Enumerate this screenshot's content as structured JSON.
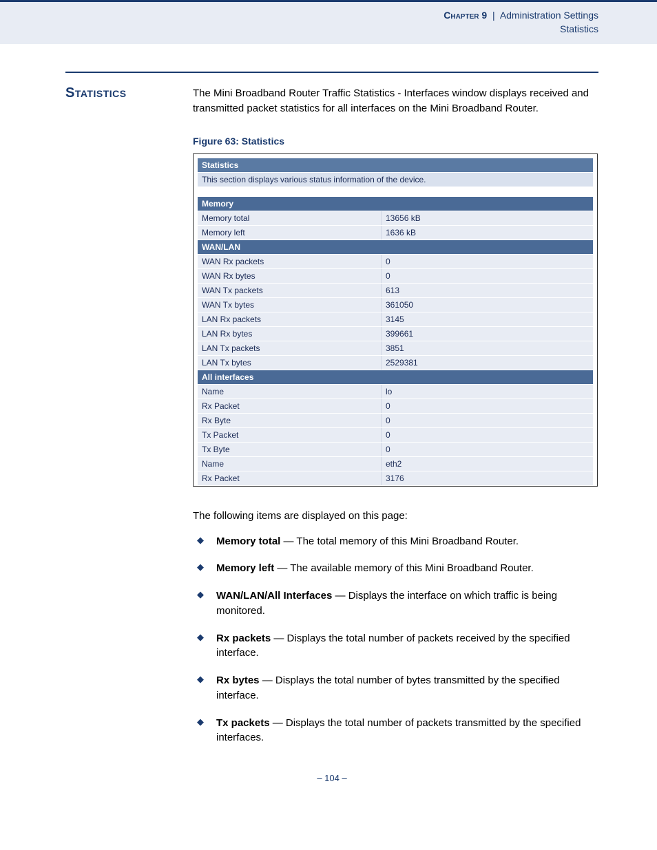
{
  "header": {
    "chapter": "Chapter 9",
    "sep": "|",
    "section": "Administration Settings",
    "sub": "Statistics"
  },
  "title": "Statistics",
  "intro": "The Mini Broadband Router Traffic Statistics - Interfaces window displays received and transmitted packet statistics for all interfaces on the Mini Broadband Router.",
  "figcap": "Figure 63:  Statistics",
  "panel": {
    "title": "Statistics",
    "subtitle": "This section displays various status information of the device.",
    "memory_hdr": "Memory",
    "memory": [
      {
        "k": "Memory total",
        "v": "13656 kB"
      },
      {
        "k": "Memory left",
        "v": "1636 kB"
      }
    ],
    "wanlan_hdr": "WAN/LAN",
    "wanlan": [
      {
        "k": "WAN Rx packets",
        "v": "0"
      },
      {
        "k": "WAN Rx bytes",
        "v": "0"
      },
      {
        "k": "WAN Tx packets",
        "v": "613"
      },
      {
        "k": "WAN Tx bytes",
        "v": "361050"
      },
      {
        "k": "LAN Rx packets",
        "v": "3145"
      },
      {
        "k": "LAN Rx bytes",
        "v": "399661"
      },
      {
        "k": "LAN Tx packets",
        "v": "3851"
      },
      {
        "k": "LAN Tx bytes",
        "v": "2529381"
      }
    ],
    "all_hdr": "All interfaces",
    "all": [
      {
        "k": "Name",
        "v": "lo"
      },
      {
        "k": "Rx Packet",
        "v": "0"
      },
      {
        "k": "Rx Byte",
        "v": "0"
      },
      {
        "k": "Tx Packet",
        "v": "0"
      },
      {
        "k": "Tx Byte",
        "v": "0"
      },
      {
        "k": "Name",
        "v": "eth2"
      },
      {
        "k": "Rx Packet",
        "v": "3176"
      }
    ]
  },
  "lead": "The following items are displayed on this page:",
  "items": [
    {
      "b": "Memory total",
      "t": " — The total memory of this Mini Broadband Router."
    },
    {
      "b": "Memory left",
      "t": " — The available memory of this Mini Broadband Router."
    },
    {
      "b": "WAN/LAN/All Interfaces",
      "t": " — Displays the interface on which traffic is being monitored."
    },
    {
      "b": "Rx packets",
      "t": " — Displays the total number of packets received by the specified interface."
    },
    {
      "b": "Rx bytes",
      "t": " — Displays the total number of bytes transmitted by the specified interface."
    },
    {
      "b": "Tx packets",
      "t": " — Displays the total number of packets transmitted by the specified interfaces."
    }
  ],
  "pagenum": "–  104  –"
}
